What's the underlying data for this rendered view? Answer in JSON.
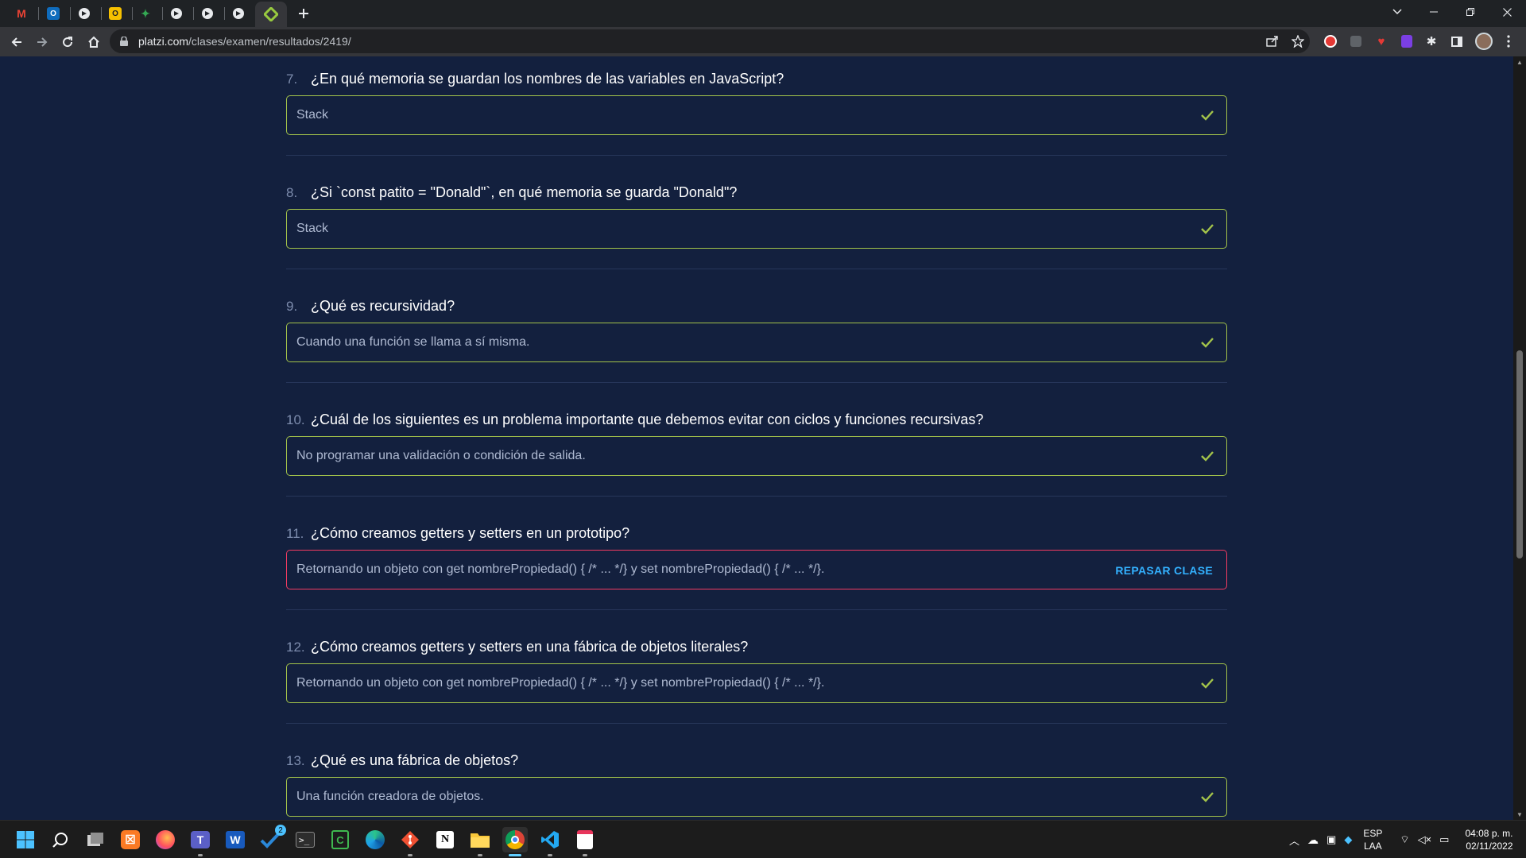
{
  "browser": {
    "url_host": "platzi.com",
    "url_path": "/clases/examen/resultados/2419/",
    "tabs": [
      {
        "icon": "gmail-icon",
        "color": "#ea4335",
        "glyph": "M"
      },
      {
        "icon": "outlook-icon",
        "color": "#0f6cbd",
        "glyph": "O"
      },
      {
        "icon": "web-icon",
        "color": "#e8eaed",
        "glyph": ""
      },
      {
        "icon": "yellow-app-icon",
        "color": "#f6c000",
        "glyph": "O"
      },
      {
        "icon": "sparkle-icon",
        "color": "#34a853",
        "glyph": "✦"
      },
      {
        "icon": "web-icon",
        "color": "#e8eaed",
        "glyph": ""
      },
      {
        "icon": "web-icon",
        "color": "#e8eaed",
        "glyph": ""
      },
      {
        "icon": "web-icon",
        "color": "#e8eaed",
        "glyph": ""
      },
      {
        "icon": "platzi-icon",
        "color": "#98ca3f",
        "glyph": "◆"
      }
    ]
  },
  "questions": [
    {
      "number": "7.",
      "text": "¿En qué memoria se guardan los nombres de las variables en JavaScript?",
      "answer": "Stack",
      "status": "correct"
    },
    {
      "number": "8.",
      "text": "¿Si `const patito = \"Donald\"`, en qué memoria se guarda \"Donald\"?",
      "answer": "Stack",
      "status": "correct"
    },
    {
      "number": "9.",
      "text": "¿Qué es recursividad?",
      "answer": "Cuando una función se llama a sí misma.",
      "status": "correct"
    },
    {
      "number": "10.",
      "text": "¿Cuál de los siguientes es un problema importante que debemos evitar con ciclos y funciones recursivas?",
      "answer": "No programar una validación o condición de salida.",
      "status": "correct"
    },
    {
      "number": "11.",
      "text": "¿Cómo creamos getters y setters en un prototipo?",
      "answer": "Retornando un objeto con get nombrePropiedad() { /* ... */} y set nombrePropiedad() { /* ... */}.",
      "status": "incorrect",
      "action": "REPASAR CLASE"
    },
    {
      "number": "12.",
      "text": "¿Cómo creamos getters y setters en una fábrica de objetos literales?",
      "answer": "Retornando un objeto con get nombrePropiedad() { /* ... */} y set nombrePropiedad() { /* ... */}.",
      "status": "correct"
    },
    {
      "number": "13.",
      "text": "¿Qué es una fábrica de objetos?",
      "answer": "Una función creadora de objetos.",
      "status": "correct"
    }
  ],
  "colors": {
    "page_bg": "#13203e",
    "correct_border": "#a3c34a",
    "incorrect_border": "#f23b62",
    "action_link": "#33b1ff"
  },
  "taskbar": {
    "language_line1": "ESP",
    "language_line2": "LAA",
    "time": "04:08 p. m.",
    "date": "02/11/2022",
    "apps": [
      "windows-start-icon",
      "search-icon",
      "task-view-icon",
      "xampp-icon",
      "firefox-icon",
      "teams-icon",
      "word-icon",
      "todo-icon",
      "terminal-icon",
      "calculator-icon",
      "edge-icon",
      "git-icon",
      "notion-icon",
      "file-explorer-icon",
      "chrome-icon",
      "vscode-icon",
      "snipping-tool-icon"
    ],
    "todo_badge": "2"
  }
}
